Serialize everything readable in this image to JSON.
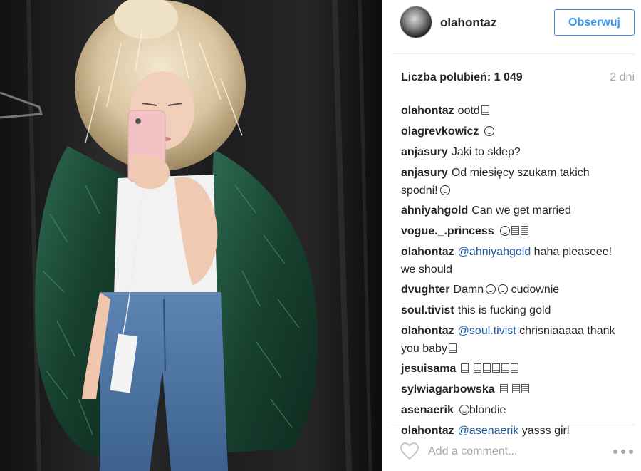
{
  "post": {
    "image_alt_icon": "mirror-selfie-photo"
  },
  "header": {
    "username": "olahontaz",
    "follow_label": "Obserwuj",
    "accent_color": "#3897f0"
  },
  "likes": {
    "label": "Liczba polubień: 1 049",
    "time_ago": "2 dni"
  },
  "comments": [
    {
      "author": "olahontaz",
      "text": "ootd",
      "emoji": "box1"
    },
    {
      "author": "olagrevkowicz",
      "text": "",
      "emoji": "face1"
    },
    {
      "author": "anjasury",
      "text": "Jaki to sklep?"
    },
    {
      "author": "anjasury",
      "text": "Od miesięcy szukam takich spodni!",
      "emoji": "face1"
    },
    {
      "author": "ahniyahgold",
      "text": "Can we get married"
    },
    {
      "author": "vogue._.princess",
      "text": "",
      "emoji": "face1+box2"
    },
    {
      "author": "olahontaz",
      "mention": "@ahniyahgold",
      "text": "haha pleaseee! we should"
    },
    {
      "author": "dvughter",
      "text_before": "Damn",
      "text_after": "cudownie",
      "emoji": "face2"
    },
    {
      "author": "soul.tivist",
      "text": "this is fucking gold"
    },
    {
      "author": "olahontaz",
      "mention": "@soul.tivist",
      "text": "chrisniaaaaa thank you baby",
      "emoji": "box1"
    },
    {
      "author": "jesuisama",
      "text": "",
      "emoji": "box6"
    },
    {
      "author": "sylwiagarbowska",
      "text": "",
      "emoji": "box2"
    },
    {
      "author": "asenaerik",
      "text": "blondie",
      "emoji": "face1-before"
    },
    {
      "author": "olahontaz",
      "mention": "@asenaerik",
      "text": "yasss girl"
    }
  ],
  "footer": {
    "comment_placeholder": "Add a comment...",
    "like_icon": "heart-icon",
    "more_icon": "more-options-icon"
  }
}
